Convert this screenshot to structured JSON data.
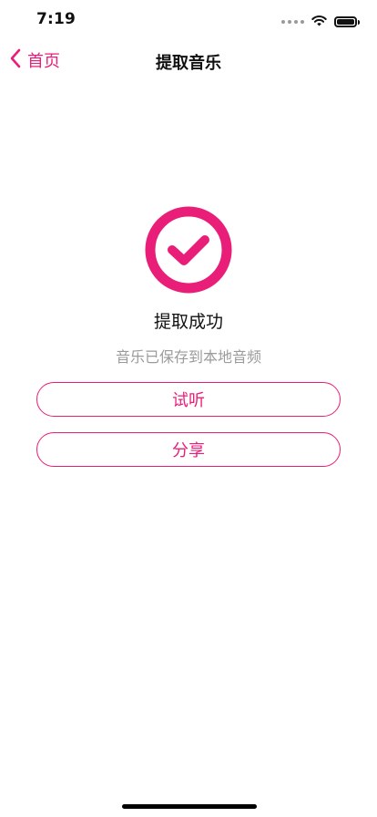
{
  "status_bar": {
    "time": "7:19",
    "icons": [
      "signal-icon",
      "wifi-icon",
      "battery-icon"
    ]
  },
  "nav": {
    "back_label": "首页",
    "back_icon": "chevron-left-icon",
    "title": "提取音乐"
  },
  "result": {
    "icon": "check-circle-icon",
    "title": "提取成功",
    "subtitle": "音乐已保存到本地音频"
  },
  "actions": {
    "listen_label": "试听",
    "share_label": "分享"
  },
  "colors": {
    "accent": "#e91e78",
    "text": "#111111",
    "muted": "#9b9b9b",
    "background": "#ffffff"
  }
}
